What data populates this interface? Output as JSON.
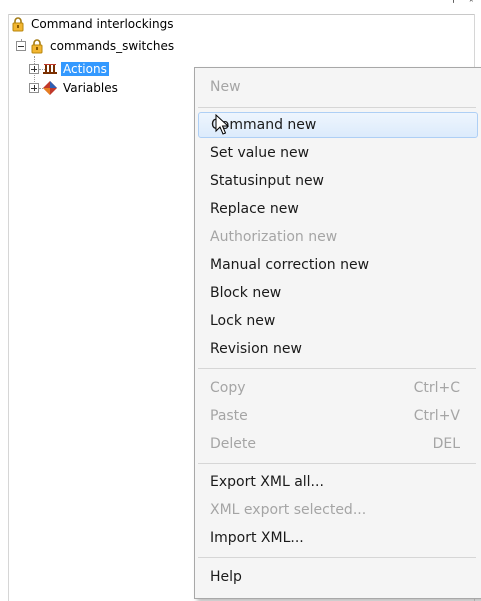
{
  "tree": {
    "root_label": "Command interlockings",
    "child_label": "commands_switches",
    "items": [
      {
        "label": "Actions",
        "icon": "actions-icon",
        "selected": true
      },
      {
        "label": "Variables",
        "icon": "variables-icon",
        "selected": false
      }
    ]
  },
  "context_menu": {
    "header": "New",
    "items": [
      {
        "label": "Command new",
        "enabled": true,
        "highlighted": true
      },
      {
        "label": "Set value new",
        "enabled": true
      },
      {
        "label": "Statusinput new",
        "enabled": true
      },
      {
        "label": "Replace new",
        "enabled": true
      },
      {
        "label": "Authorization new",
        "enabled": false
      },
      {
        "label": "Manual correction new",
        "enabled": true
      },
      {
        "label": "Block new",
        "enabled": true
      },
      {
        "label": "Lock new",
        "enabled": true
      },
      {
        "label": "Revision new",
        "enabled": true
      }
    ],
    "edit_items": [
      {
        "label": "Copy",
        "shortcut": "Ctrl+C",
        "enabled": false
      },
      {
        "label": "Paste",
        "shortcut": "Ctrl+V",
        "enabled": false
      },
      {
        "label": "Delete",
        "shortcut": "DEL",
        "enabled": false
      }
    ],
    "xml_items": [
      {
        "label": "Export XML all...",
        "enabled": true
      },
      {
        "label": "XML export selected...",
        "enabled": false
      },
      {
        "label": "Import XML...",
        "enabled": true
      }
    ],
    "help_label": "Help"
  },
  "colors": {
    "selection": "#3399ff",
    "menu_background": "#f5f5f5",
    "disabled_text": "#a5a5a5"
  }
}
